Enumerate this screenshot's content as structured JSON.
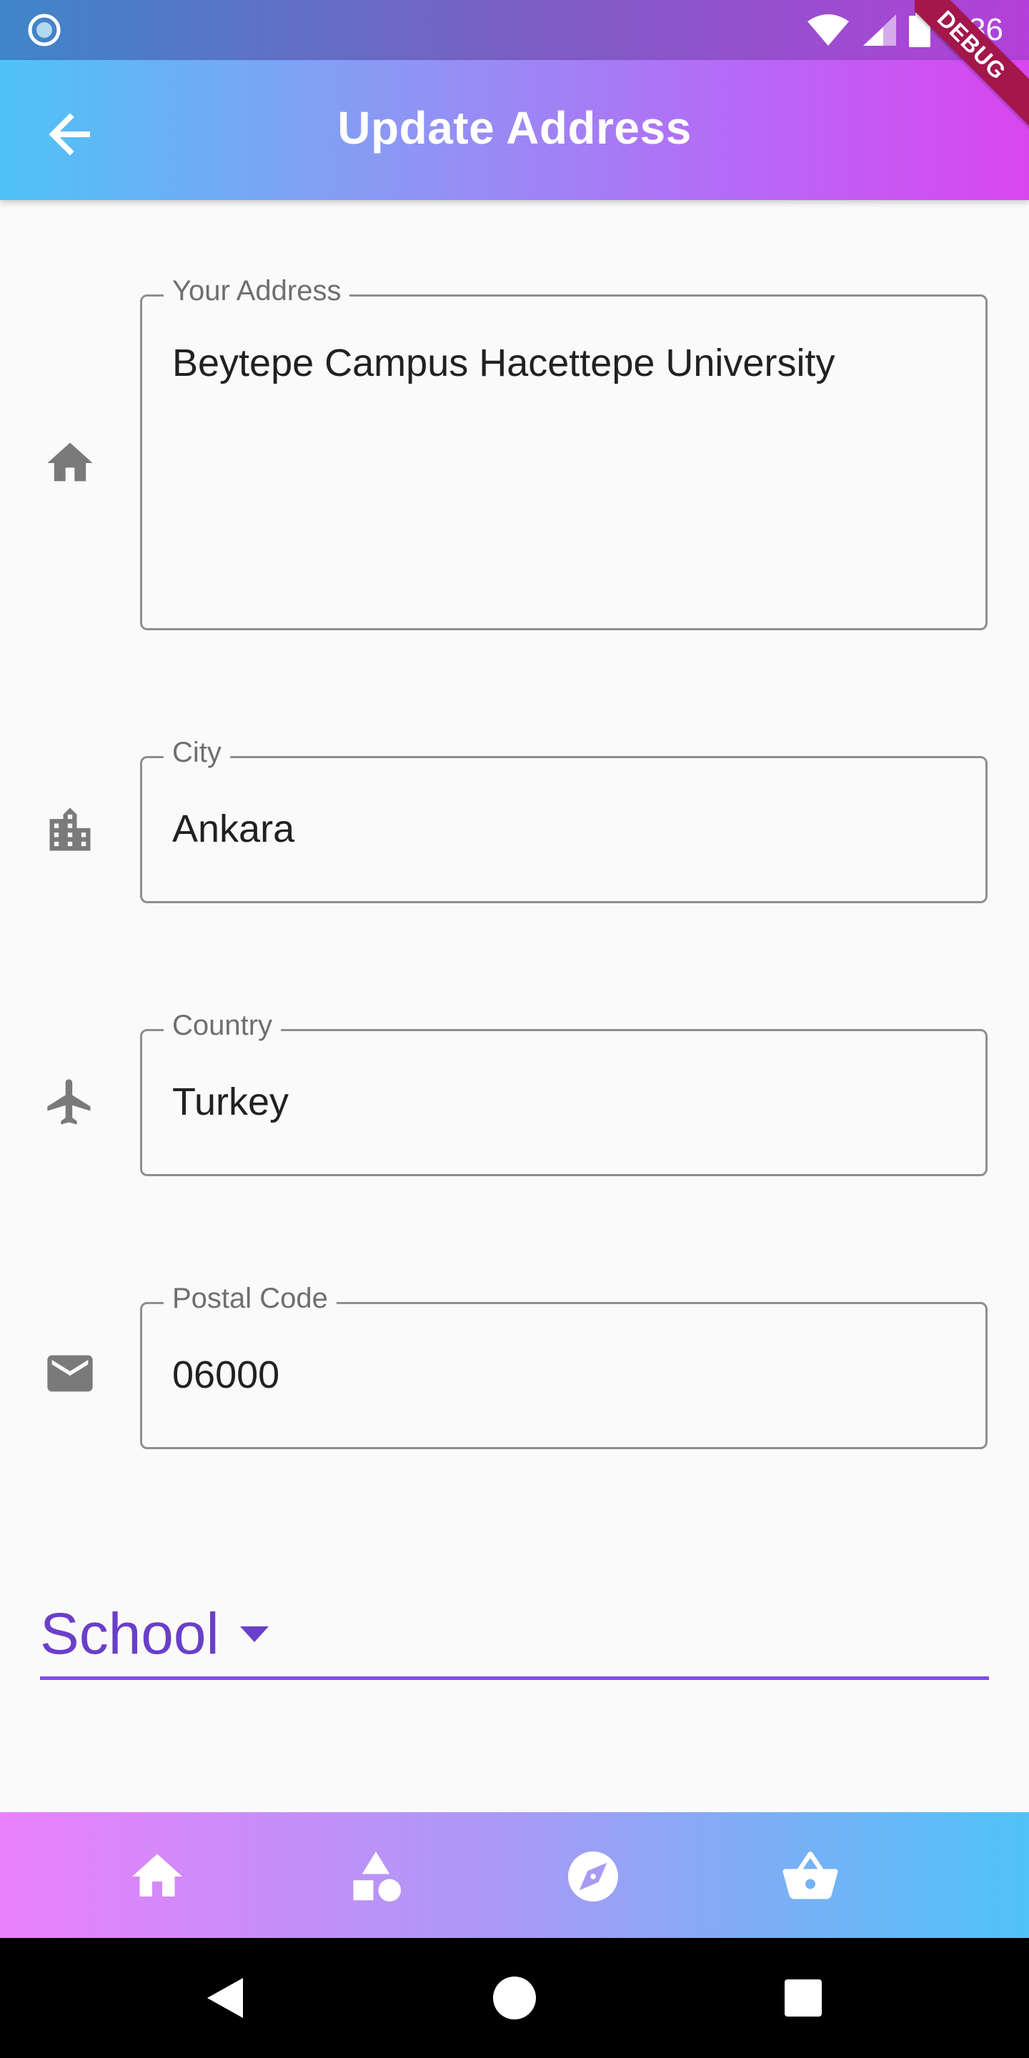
{
  "status_bar": {
    "time": "1:36"
  },
  "app_bar": {
    "title": "Update Address",
    "debug_label": "DEBUG"
  },
  "form": {
    "address": {
      "label": "Your Address",
      "value": "Beytepe Campus Hacettepe University",
      "icon": "home-icon"
    },
    "city": {
      "label": "City",
      "value": "Ankara",
      "icon": "location-city-icon"
    },
    "country": {
      "label": "Country",
      "value": "Turkey",
      "icon": "airplane-icon"
    },
    "postal_code": {
      "label": "Postal Code",
      "value": "06000",
      "icon": "mail-icon"
    },
    "address_type": {
      "selected": "School"
    }
  },
  "bottom_nav": [
    "home-icon",
    "category-icon",
    "explore-icon",
    "basket-icon"
  ],
  "colors": {
    "app_bar_start": "#4fc3f7",
    "app_bar_end": "#d946ef",
    "dropdown_accent": "#7c4dea",
    "field_border": "#8e8e8e",
    "icon_gray": "#7a7a7a"
  }
}
